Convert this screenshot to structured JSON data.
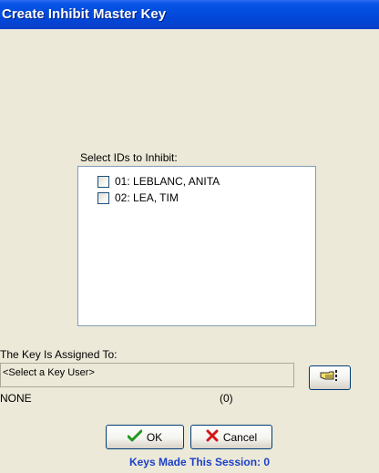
{
  "window": {
    "title": "Create Inhibit Master Key"
  },
  "ids_section": {
    "label": "Select IDs to Inhibit:",
    "items": [
      {
        "label": "01: LEBLANC, ANITA",
        "checked": false
      },
      {
        "label": "02: LEA, TIM",
        "checked": false
      }
    ]
  },
  "assignment": {
    "label": "The Key Is Assigned To:",
    "user_value": "<Select a Key User>",
    "select_icon": "pointing-hand-icon",
    "assigned_name": "NONE",
    "assigned_count": "(0)"
  },
  "buttons": {
    "ok_label": "OK",
    "ok_icon": "checkmark-icon",
    "cancel_label": "Cancel",
    "cancel_icon": "x-icon"
  },
  "status": {
    "session_text": "Keys Made This Session: 0",
    "session_color": "#1c3fc8"
  },
  "colors": {
    "title_bar": "#0345d6",
    "background": "#ece9d8",
    "ok_check": "#1e9a1e",
    "cancel_x": "#d01818"
  }
}
